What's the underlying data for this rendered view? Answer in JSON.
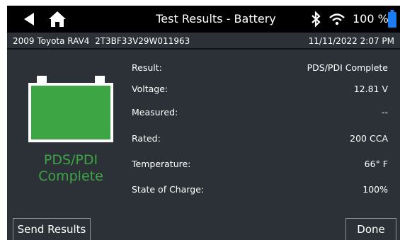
{
  "topbar": {
    "title": "Test Results - Battery",
    "battery_percent": "100 %",
    "icons": [
      "back-arrow-icon",
      "home-icon",
      "bluetooth-icon",
      "wifi-icon",
      "battery-icon"
    ],
    "battery_icon_color": "#1a7cf0"
  },
  "vehicle": {
    "description": "2009 Toyota RAV4  2T3BF33V29W011963",
    "datetime": "11/11/2022 2:07 PM"
  },
  "battery_graphic": {
    "fill_color": "#3ea545",
    "status_line1": "PDS/PDI",
    "status_line2": "Complete",
    "status_color": "#3ea545"
  },
  "results": [
    {
      "label": "Result:",
      "value": "PDS/PDI Complete"
    },
    {
      "label": "Voltage:",
      "value": "12.81 V"
    },
    {
      "label": "Measured:",
      "value": "--"
    },
    {
      "label": "Rated:",
      "value": "200 CCA"
    },
    {
      "label": "Temperature:",
      "value": "66° F"
    },
    {
      "label": "State of Charge:",
      "value": "100%"
    }
  ],
  "buttons": {
    "send": "Send Results",
    "done": "Done"
  }
}
